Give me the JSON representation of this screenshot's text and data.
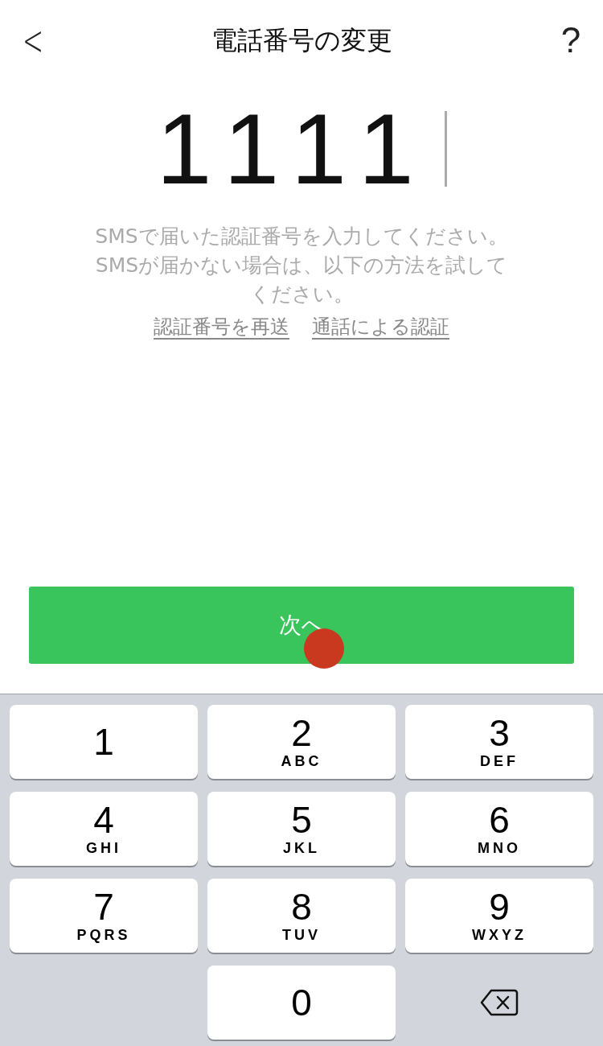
{
  "header": {
    "back": "<",
    "title": "電話番号の変更",
    "help": "?"
  },
  "code": {
    "value": "1111"
  },
  "message": "SMSで届いた認証番号を入力してください。SMSが届かない場合は、以下の方法を試してください。",
  "links": [
    "認証番号を再送",
    "通話による認証"
  ],
  "next_button": {
    "label": "次へ"
  },
  "keypad": [
    {
      "kind": "digit",
      "digit": "1"
    },
    {
      "kind": "digit",
      "digit": "2",
      "letters": "ABC"
    },
    {
      "kind": "digit",
      "digit": "3",
      "letters": "DEF"
    },
    {
      "kind": "digit",
      "digit": "4",
      "letters": "GHI"
    },
    {
      "kind": "digit",
      "digit": "5",
      "letters": "JKL"
    },
    {
      "kind": "digit",
      "digit": "6",
      "letters": "MNO"
    },
    {
      "kind": "digit",
      "digit": "7",
      "letters": "PQRS"
    },
    {
      "kind": "digit",
      "digit": "8",
      "letters": "TUV"
    },
    {
      "kind": "digit",
      "digit": "9",
      "letters": "WXYZ"
    },
    {
      "kind": "blank"
    },
    {
      "kind": "digit",
      "digit": "0"
    },
    {
      "kind": "delete"
    }
  ]
}
